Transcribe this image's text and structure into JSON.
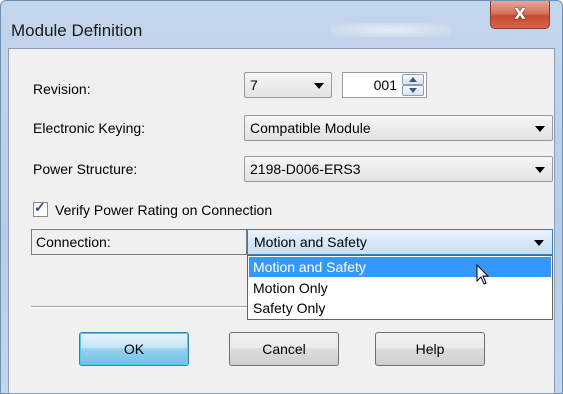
{
  "window": {
    "title": "Module Definition",
    "close_glyph": "X"
  },
  "form": {
    "revision_label": "Revision:",
    "revision_major": "7",
    "revision_minor": "001",
    "keying_label": "Electronic Keying:",
    "keying_value": "Compatible Module",
    "power_label": "Power Structure:",
    "power_value": "2198-D006-ERS3",
    "verify_label": "Verify Power Rating on Connection",
    "verify_checked": true,
    "connection_label": "Connection:",
    "connection_value": "Motion and Safety"
  },
  "connection_options": [
    "Motion and Safety",
    "Motion Only",
    "Safety Only"
  ],
  "buttons": {
    "ok": "OK",
    "cancel": "Cancel",
    "help": "Help"
  },
  "colors": {
    "selection": "#3399ff",
    "close_button": "#c84a32"
  }
}
